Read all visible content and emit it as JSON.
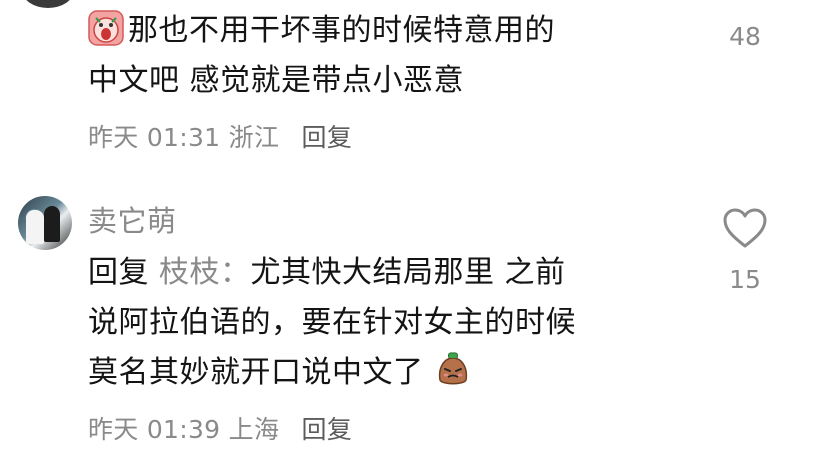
{
  "top_comment": {
    "text_line1": "那也不用干坏事的时候特意用的",
    "text_line2": "中文吧 感觉就是带点小恶意",
    "emoji": "face-screaming-emoji",
    "time": "昨天 01:31",
    "location": "浙江",
    "reply_label": "回复",
    "like_count": "48"
  },
  "reply_comment": {
    "username": "卖它萌",
    "reply_prefix": "回复",
    "reply_to": "枝枝：",
    "text_line1": "尤其快大结局那里 之前",
    "text_line2": "说阿拉伯语的，要在针对女主的时候",
    "text_line3": "莫名其妙就开口说中文了",
    "emoji": "confused-potato-emoji",
    "time": "昨天 01:39",
    "location": "上海",
    "reply_label": "回复",
    "like_count": "15"
  },
  "icons": {
    "like": "heart-outline-icon"
  },
  "colors": {
    "text": "#141414",
    "meta": "#8a8a8a",
    "icon": "#8a8a8a"
  }
}
